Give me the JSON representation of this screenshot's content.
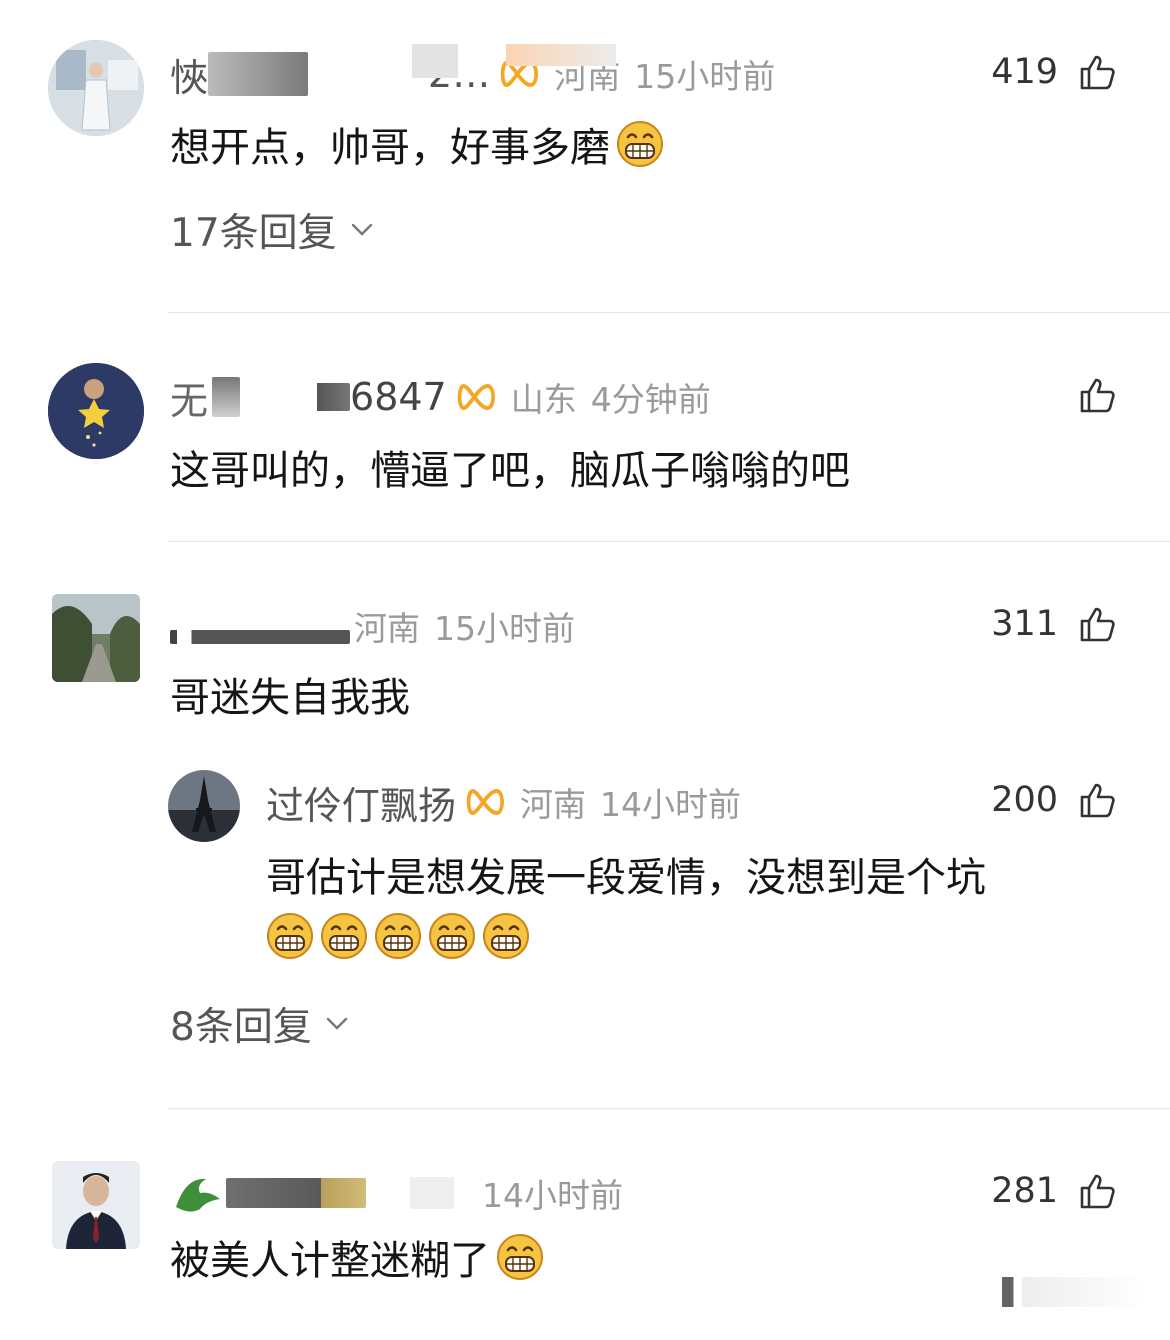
{
  "comments": [
    {
      "name_visible": "悏",
      "name_tail": "2…",
      "location": "河南",
      "time": "15小时前",
      "likes": "419",
      "text": "想开点，帅哥，好事多磨",
      "emoji_count": 1,
      "replies": "17条回复",
      "avatar": "person-photo-avatar"
    },
    {
      "name_visible": "无",
      "name_tail": "6847",
      "location": "山东",
      "time": "4分钟前",
      "likes": "",
      "text": "这哥叫的，懵逼了吧，脑瓜子嗡嗡的吧",
      "avatar": "star-night-avatar"
    },
    {
      "name_visible": "",
      "location": "河南",
      "time": "15小时前",
      "likes": "311",
      "text": "哥迷失自我我",
      "avatar": "street-photo-avatar",
      "reply": {
        "name": "过伶仃飘扬",
        "location": "河南",
        "time": "14小时前",
        "likes": "200",
        "text": "哥估计是想发展一段爱情，没想到是个坑",
        "emoji_count": 5,
        "avatar": "eiffel-tower-avatar"
      },
      "replies": "8条回复"
    },
    {
      "name_visible": "",
      "location": "",
      "time": "14小时前",
      "likes": "281",
      "text": "被美人计整迷糊了",
      "emoji_count": 1,
      "avatar": "man-suit-avatar"
    }
  ],
  "colors": {
    "vip_orange": "#f5a623",
    "meta_gray": "#9a9a9a",
    "divider": "#e6e6e6"
  },
  "icons": {
    "like": "thumbs-up-icon",
    "vip": "vip-badge-icon",
    "expand": "chevron-down-icon",
    "emoji": "grin-emoji-icon"
  }
}
